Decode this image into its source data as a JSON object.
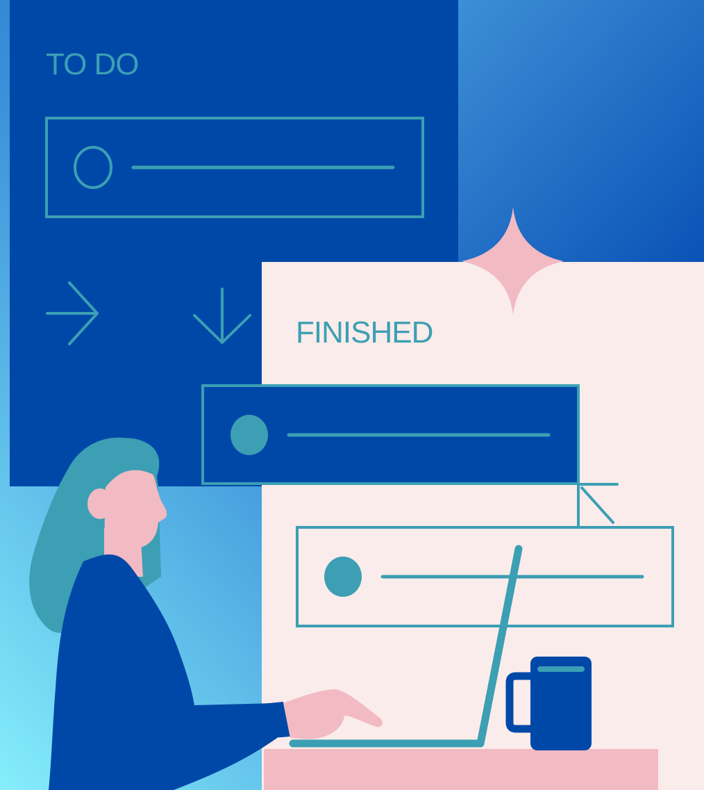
{
  "todo_panel": {
    "title": "TO DO"
  },
  "finished_panel": {
    "title": "FINISHED"
  },
  "colors": {
    "navy": "#0048a8",
    "teal": "#3c9fb4",
    "pink": "#f2bac2",
    "cream": "#faecea",
    "sky_gradient_start": "#86eefb",
    "sky_gradient_end": "#0650b5"
  },
  "icons": [
    "right-arrow-icon",
    "down-arrow-icon",
    "sparkle-icon",
    "cursor-pointer-icon",
    "mug-icon",
    "laptop-icon"
  ]
}
